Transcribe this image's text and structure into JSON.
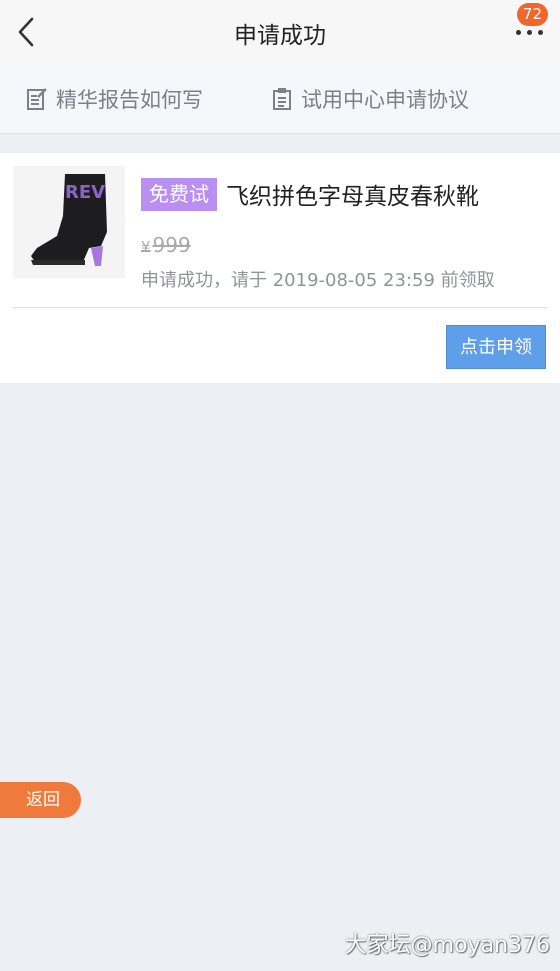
{
  "header": {
    "title": "申请成功",
    "notification_count": "72",
    "back_icon": "chevron-left-icon",
    "more_icon": "more-dots-icon"
  },
  "links": [
    {
      "label": "精华报告如何写",
      "icon": "edit-document-icon"
    },
    {
      "label": "试用中心申请协议",
      "icon": "clipboard-icon"
    }
  ],
  "card": {
    "tag": "免费试",
    "product_name": "飞织拼色字母真皮春秋靴",
    "currency": "¥",
    "price": "999",
    "status": "申请成功，请于 2019-08-05 23:59 前领取",
    "claim_button": "点击申领",
    "image_text": "REV"
  },
  "return_button": "返回",
  "watermark": "大家坛@moyan376",
  "colors": {
    "tag_bg": "#b98ff2",
    "claim_bg": "#5f9ee9",
    "badge_bg": "#f0662b",
    "return_bg": "#f07a3b"
  }
}
